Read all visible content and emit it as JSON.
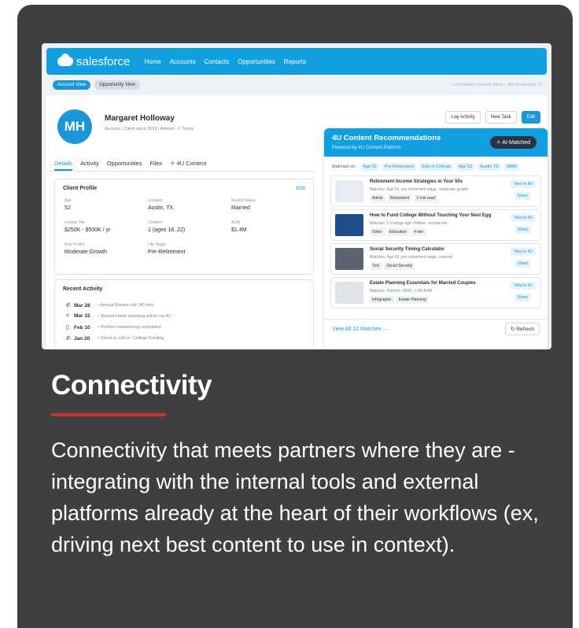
{
  "heading": "Connectivity",
  "description": "Connectivity that meets partners where they are - integrating with the internal tools and external platforms already at the heart of their workflows (ex, driving next best content to use in context).",
  "colors": {
    "card_bg": "#3f3f41",
    "accent_red": "#c0392b",
    "salesforce_blue": "#129fe0"
  },
  "screenshot": {
    "brand": "salesforce",
    "nav": [
      "Home",
      "Accounts",
      "Contacts",
      "Opportunities",
      "Reports"
    ],
    "views": {
      "account": "Account View",
      "opportunity": "Opportunity View"
    },
    "watermark": "Low-Fidelity Context Mock – Not Production UI",
    "client": {
      "initials": "MH",
      "name": "Margaret Holloway",
      "meta": "Account | Client since 2019 | Advisor: J. Torres"
    },
    "actions": {
      "log": "Log Activity",
      "task": "New Task",
      "edit": "Edit"
    },
    "tabs": [
      "Details",
      "Activity",
      "Opportunities",
      "Files",
      "4U Content"
    ],
    "profile": {
      "title": "Client Profile",
      "edit": "Edit",
      "fields": [
        {
          "label": "Age",
          "value": "52"
        },
        {
          "label": "Location",
          "value": "Austin, TX"
        },
        {
          "label": "Marital Status",
          "value": "Married"
        },
        {
          "label": "Income Tier",
          "value": "$250K - $500K / yr"
        },
        {
          "label": "Children",
          "value": "2 (ages 18, 22)"
        },
        {
          "label": "AUM",
          "value": "$1.4M"
        },
        {
          "label": "Risk Profile",
          "value": "Moderate Growth"
        },
        {
          "label": "Life Stage",
          "value": "Pre-Retirement"
        }
      ]
    },
    "recent": {
      "title": "Recent Activity",
      "rows": [
        {
          "icon": "phone-icon",
          "date": "Mar 28",
          "text": "• Annual Review call (45 min)"
        },
        {
          "icon": "share-icon",
          "date": "Mar 15",
          "text": "• Shared estate planning article via 4U"
        },
        {
          "icon": "document-icon",
          "date": "Feb 10",
          "text": "• Portfolio rebalancing completed"
        },
        {
          "icon": "phone-icon",
          "date": "Jan 20",
          "text": "• Check-in call re: College Funding"
        }
      ]
    },
    "recommendations": {
      "title": "4U Content Recommendations",
      "subtitle": "Powered by 4U Content Platform",
      "badge": "AI-Matched",
      "matched_label": "Matched on:",
      "matched_tags": [
        "Age 52",
        "Pre-Retirement",
        "Kids in College",
        "Age 52",
        "Austin TX",
        "HNW"
      ],
      "items": [
        {
          "title": "Retirement Income Strategies in Your 50s",
          "match": "Matches: Age 52, pre-retirement stage, moderate growth",
          "tags": [
            "Article",
            "Retirement",
            "2 min read"
          ],
          "view": "View in 4U",
          "share": "Share",
          "thumb_color": "#e6ecf2"
        },
        {
          "title": "How to Fund College Without Touching Your Nest Egg",
          "match": "Matches: 2 College-age children, income tier",
          "tags": [
            "Video",
            "Education",
            "4 min"
          ],
          "view": "View in 4U",
          "share": "Share",
          "thumb_color": "#1f4e89"
        },
        {
          "title": "Social Security Timing Calculator",
          "match": "Matches: Age 52, pre-retirement stage, married",
          "tags": [
            "Tool",
            "Social Security"
          ],
          "view": "View in 4U",
          "share": "Share",
          "thumb_color": "#5b6470"
        },
        {
          "title": "Estate Planning Essentials for Married Couples",
          "match": "Matches: Married, HNW, 1.4M AUM",
          "tags": [
            "Infographic",
            "Estate Planning"
          ],
          "view": "View in 4U",
          "share": "Share",
          "thumb_color": "#dfe5ea"
        }
      ],
      "view_all": "View All 12 Matches",
      "refresh": "Refresh"
    }
  }
}
